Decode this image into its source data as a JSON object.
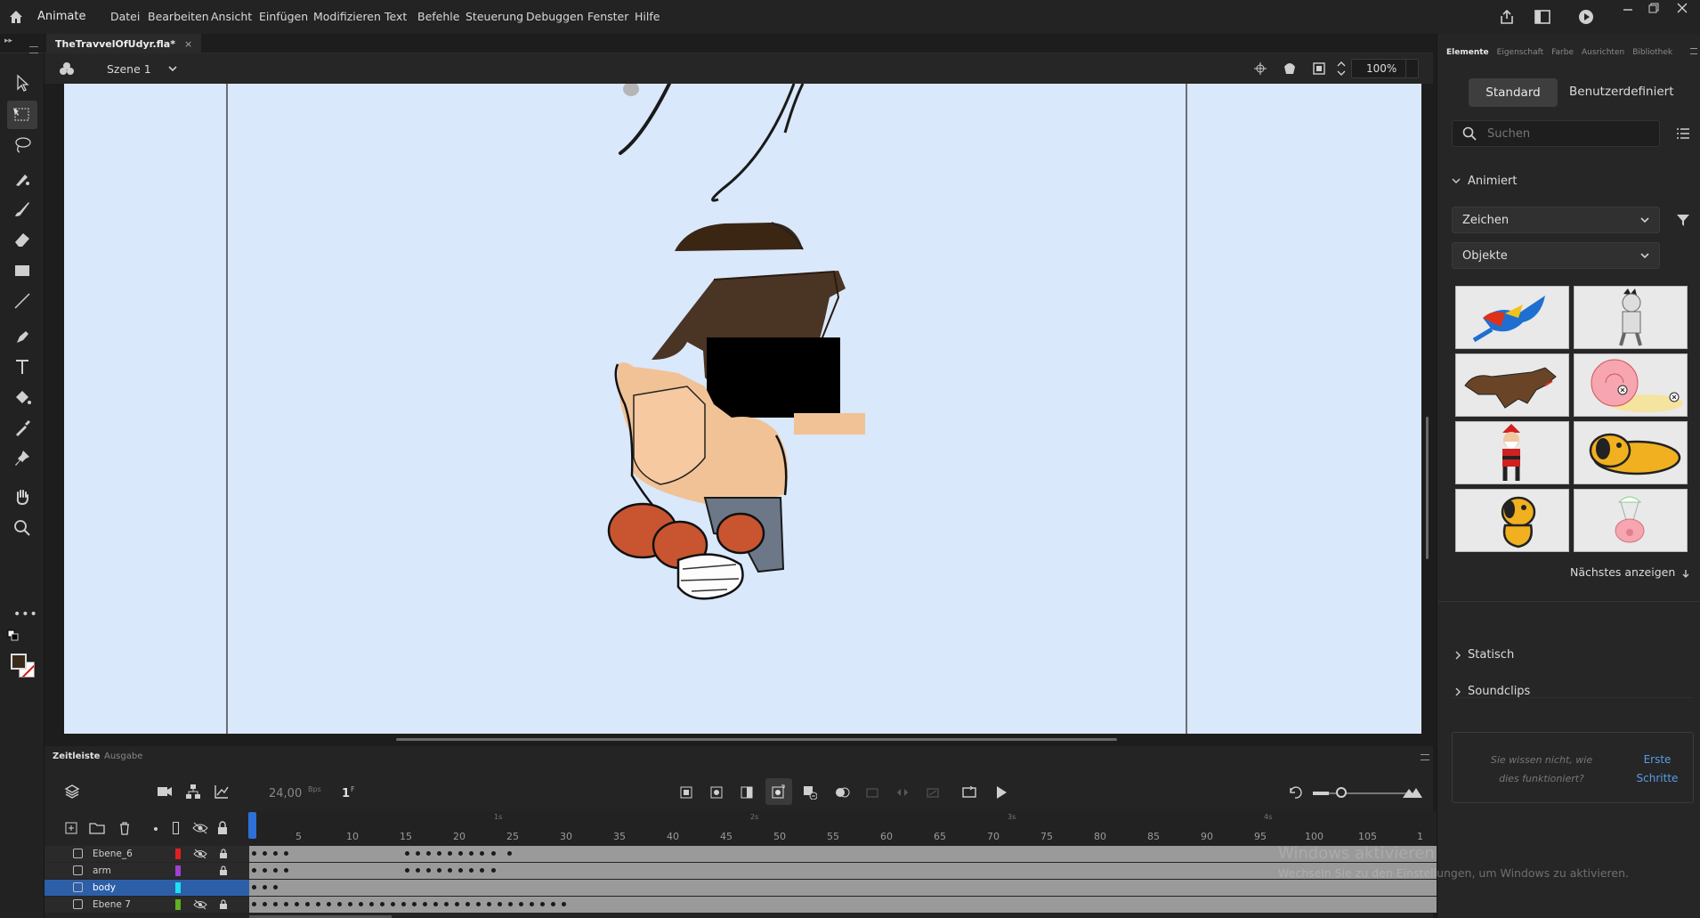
{
  "app": {
    "name": "Animate"
  },
  "menu": [
    "Datei",
    "Bearbeiten",
    "Ansicht",
    "Einfügen",
    "Modifizieren",
    "Text",
    "Befehle",
    "Steuerung",
    "Debuggen",
    "Fenster",
    "Hilfe"
  ],
  "document": {
    "tab_title": "TheTravvelOfUdyr.fla*",
    "scene": "Szene 1",
    "zoom": "100%"
  },
  "right_panel": {
    "tabs": [
      "Elemente",
      "Eigenschaft",
      "Farbe",
      "Ausrichten",
      "Bibliothek"
    ],
    "mode_buttons": [
      "Standard",
      "Benutzerdefiniert"
    ],
    "search_placeholder": "Suchen",
    "sections": {
      "animated": "Animiert",
      "static": "Statisch",
      "soundclips": "Soundclips"
    },
    "dropdown_1": "Zeichen",
    "dropdown_2": "Objekte",
    "assets": [
      "parrot",
      "mummy",
      "wolf",
      "snail",
      "santa",
      "dog-lying",
      "dog-sitting",
      "pig-parachute"
    ],
    "show_next": "Nächstes anzeigen",
    "help_text": "Sie wissen nicht, wie dies funktioniert?",
    "help_link": "Erste Schritte"
  },
  "timeline": {
    "tabs": [
      "Zeitleiste",
      "Ausgabe"
    ],
    "fps": "24,00",
    "fps_unit": "Bps",
    "frame": "1",
    "frame_unit": "F",
    "second_markers": [
      "1s",
      "2s",
      "3s",
      "4s"
    ],
    "frame_numbers": [
      "5",
      "10",
      "15",
      "20",
      "25",
      "30",
      "35",
      "40",
      "45",
      "50",
      "55",
      "60",
      "65",
      "70",
      "75",
      "80",
      "85",
      "90",
      "95",
      "100",
      "105",
      "1"
    ],
    "layers": [
      {
        "name": "Ebene_6",
        "color": "#e02020",
        "hidden": true,
        "locked": true,
        "selected": false
      },
      {
        "name": "arm",
        "color": "#a040d0",
        "hidden": false,
        "locked": true,
        "selected": false
      },
      {
        "name": "body",
        "color": "#20e0f0",
        "hidden": false,
        "locked": false,
        "selected": true
      },
      {
        "name": "Ebene 7",
        "color": "#60b020",
        "hidden": true,
        "locked": true,
        "selected": false
      }
    ]
  },
  "watermark": {
    "line1": "Windows aktivieren",
    "line2": "Wechseln Sie zu den Einstellungen, um Windows zu aktivieren."
  }
}
